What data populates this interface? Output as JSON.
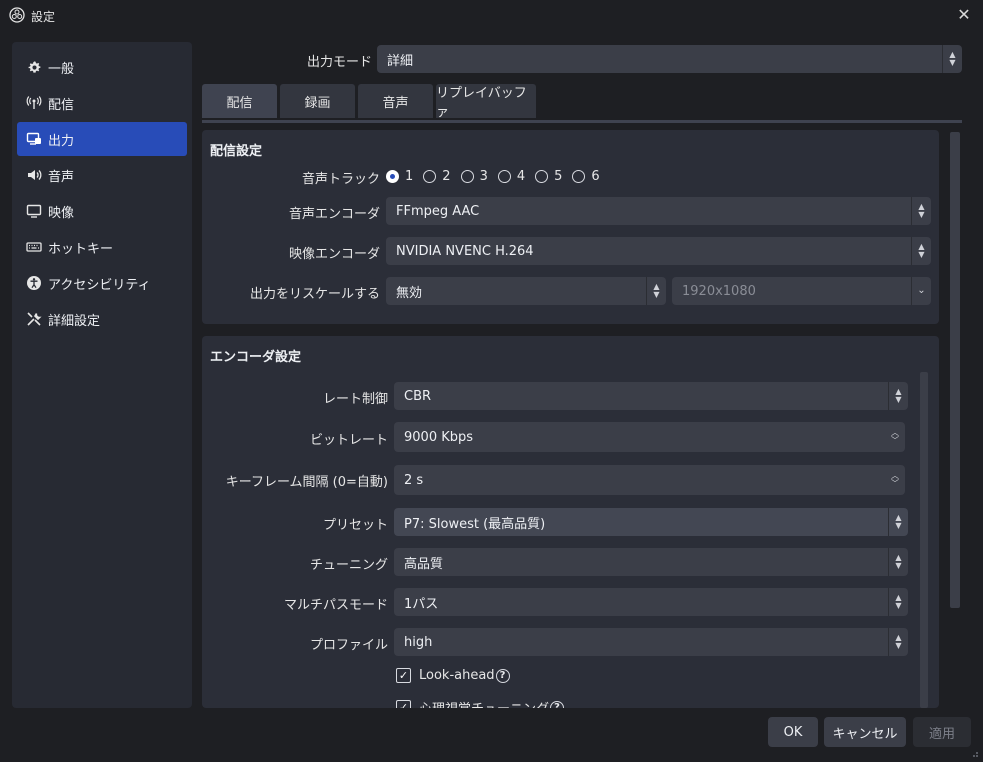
{
  "window": {
    "title": "設定",
    "close_icon": "close-icon"
  },
  "sidebar": {
    "items": [
      {
        "label": "一般",
        "icon": "gear-icon",
        "active": false
      },
      {
        "label": "配信",
        "icon": "antenna-icon",
        "active": false
      },
      {
        "label": "出力",
        "icon": "output-icon",
        "active": true
      },
      {
        "label": "音声",
        "icon": "speaker-icon",
        "active": false
      },
      {
        "label": "映像",
        "icon": "monitor-icon",
        "active": false
      },
      {
        "label": "ホットキー",
        "icon": "keyboard-icon",
        "active": false
      },
      {
        "label": "アクセシビリティ",
        "icon": "accessibility-icon",
        "active": false
      },
      {
        "label": "詳細設定",
        "icon": "tools-icon",
        "active": false
      }
    ]
  },
  "output_mode": {
    "label": "出力モード",
    "value": "詳細"
  },
  "tabs": [
    {
      "label": "配信",
      "active": true
    },
    {
      "label": "録画",
      "active": false
    },
    {
      "label": "音声",
      "active": false
    },
    {
      "label": "リプレイバッファ",
      "active": false
    }
  ],
  "stream_settings": {
    "title": "配信設定",
    "audio_track_label": "音声トラック",
    "audio_tracks": [
      "1",
      "2",
      "3",
      "4",
      "5",
      "6"
    ],
    "audio_track_selected": "1",
    "audio_encoder_label": "音声エンコーダ",
    "audio_encoder_value": "FFmpeg AAC",
    "video_encoder_label": "映像エンコーダ",
    "video_encoder_value": "NVIDIA NVENC H.264",
    "rescale_label": "出力をリスケールする",
    "rescale_value": "無効",
    "rescale_resolution": "1920x1080"
  },
  "encoder_settings": {
    "title": "エンコーダ設定",
    "rate_control_label": "レート制御",
    "rate_control_value": "CBR",
    "bitrate_label": "ビットレート",
    "bitrate_value": "9000 Kbps",
    "keyframe_label": "キーフレーム間隔 (0=自動)",
    "keyframe_value": "2 s",
    "preset_label": "プリセット",
    "preset_value": "P7: Slowest (最高品質)",
    "tuning_label": "チューニング",
    "tuning_value": "高品質",
    "multipass_label": "マルチパスモード",
    "multipass_value": "1パス",
    "profile_label": "プロファイル",
    "profile_value": "high",
    "lookahead_label": "Look-ahead",
    "lookahead_checked": true,
    "psycho_label": "心理視覚チューニング",
    "psycho_checked": true
  },
  "footer": {
    "ok_label": "OK",
    "cancel_label": "キャンセル",
    "apply_label": "適用"
  },
  "colors": {
    "accent": "#284cb8",
    "panel": "#2b2e38",
    "background": "#1e1f23"
  }
}
